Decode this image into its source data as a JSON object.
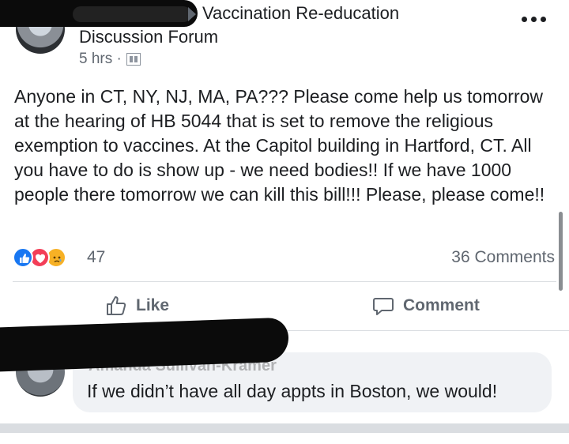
{
  "post": {
    "group_name_line1": "Vaccination Re-education",
    "group_name_line2": "Discussion Forum",
    "time": "5 hrs ·",
    "body": "Anyone in CT, NY, NJ, MA, PA??? Please come help us tomorrow at the hearing of HB 5044 that is set to remove the religious exemption to vaccines. At the Capitol building in Hartford, CT. All you have to do is show up - we need bodies!! If we have 1000 people there tomorrow we can kill this bill!!! Please, please come!!",
    "reactions": {
      "icons": [
        "like-icon",
        "love-icon",
        "sad-icon"
      ],
      "count": "47"
    },
    "comments_count": "36 Comments",
    "actions": {
      "like": "Like",
      "comment": "Comment"
    }
  },
  "comment": {
    "author": "Amanda Sullivan-Kramer",
    "text": "If we didn’t have all day appts in Boston, we would!"
  },
  "colors": {
    "like": "#1877f2",
    "love": "#f33e58",
    "sad": "#f7b125",
    "bubble": "#f0f2f5",
    "secondary_text": "#606770"
  }
}
